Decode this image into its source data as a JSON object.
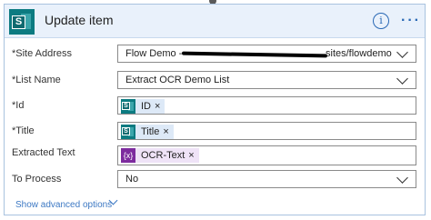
{
  "card": {
    "title": "Update item",
    "info_glyph": "i",
    "more_glyph": "···"
  },
  "fields": {
    "site_address": {
      "label": "Site Address",
      "required": "*",
      "value_start": "Flow Demo - ",
      "value_end": "sites/flowdemo"
    },
    "list_name": {
      "label": "List Name",
      "required": "*",
      "value": "Extract OCR Demo List"
    },
    "id": {
      "label": "Id",
      "required": "*",
      "token": "ID",
      "remove": "×"
    },
    "title": {
      "label": "Title",
      "required": "*",
      "token": "Title",
      "remove": "×"
    },
    "extracted_text": {
      "label": "Extracted Text",
      "token": "OCR-Text",
      "token_icon": "{x}",
      "remove": "×"
    },
    "to_process": {
      "label": "To Process",
      "value": "No"
    }
  },
  "advanced": {
    "label": "Show advanced options"
  },
  "colors": {
    "accent": "#2a69b5",
    "sharepoint": "#0c7b81",
    "variable": "#7d2b9e",
    "header_bg": "#e9f1fb"
  }
}
